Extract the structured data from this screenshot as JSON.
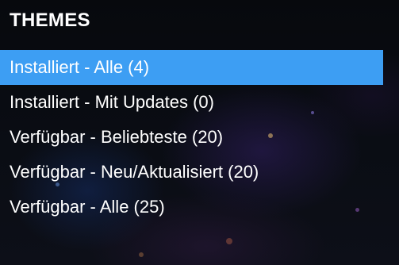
{
  "panel": {
    "title": "THEMES",
    "items": [
      {
        "label": "Installiert - Alle (4)",
        "selected": true
      },
      {
        "label": "Installiert - Mit Updates (0)",
        "selected": false
      },
      {
        "label": "Verfügbar - Beliebteste (20)",
        "selected": false
      },
      {
        "label": "Verfügbar - Neu/Aktualisiert (20)",
        "selected": false
      },
      {
        "label": "Verfügbar - Alle (25)",
        "selected": false
      }
    ]
  },
  "colors": {
    "selection": "#3d9ef3",
    "text": "#ffffff",
    "background": "#07090d"
  }
}
